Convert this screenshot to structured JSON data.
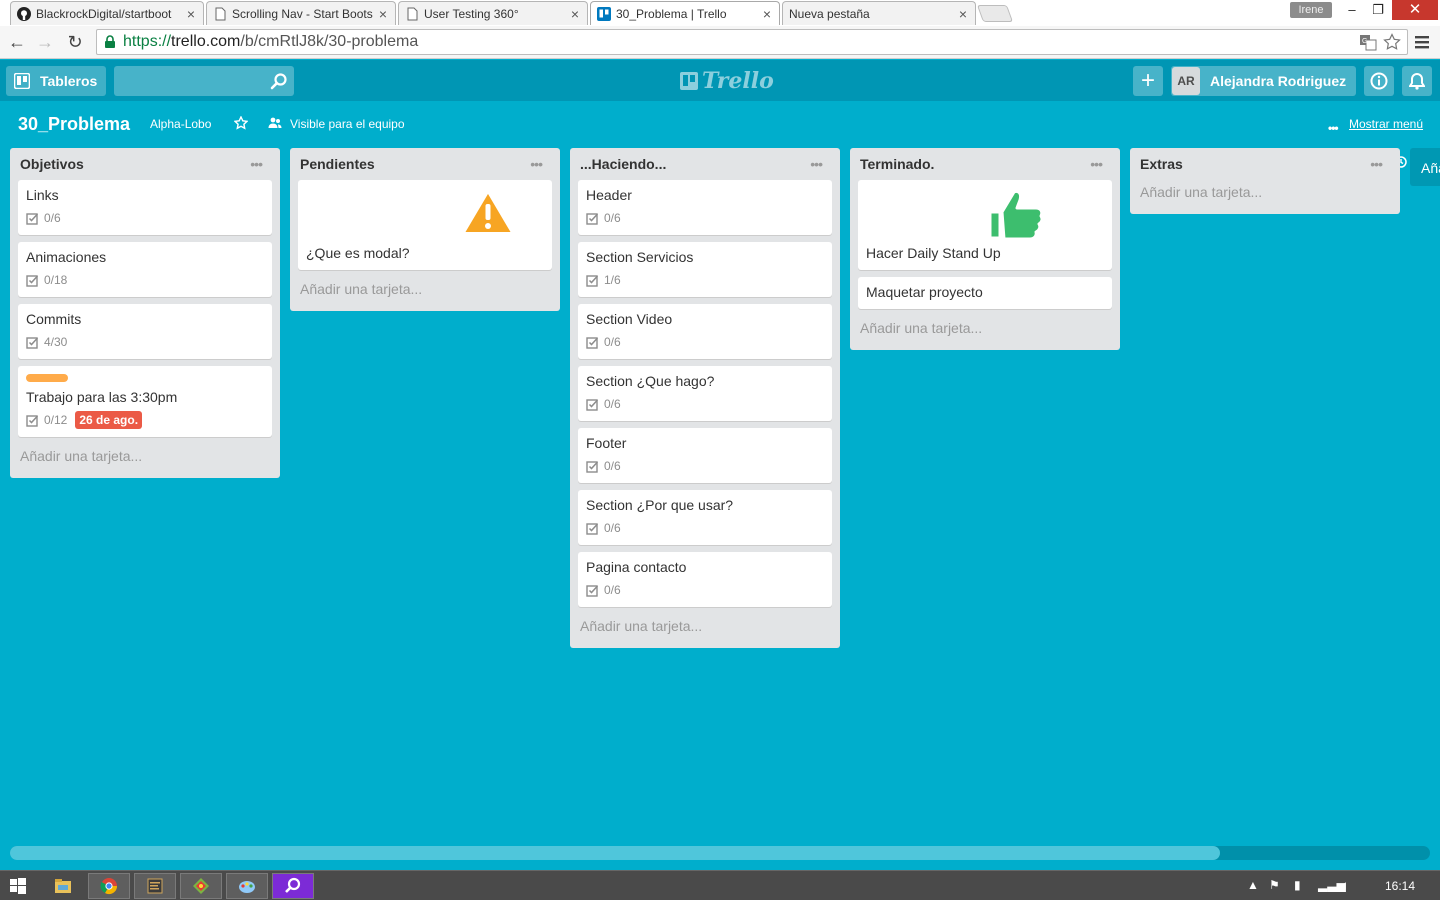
{
  "browser": {
    "tabs": [
      {
        "title": "BlackrockDigital/startboot",
        "icon": "github-icon",
        "active": false
      },
      {
        "title": "Scrolling Nav - Start Boots",
        "icon": "page-icon",
        "active": false
      },
      {
        "title": "User Testing 360°",
        "icon": "page-icon",
        "active": false
      },
      {
        "title": "30_Problema | Trello",
        "icon": "trello-icon",
        "active": true
      },
      {
        "title": "Nueva pestaña",
        "icon": "none",
        "active": false
      }
    ],
    "profile_name": "Irene",
    "url_scheme": "https://",
    "url_host": "trello.com",
    "url_path": "/b/cmRtlJ8k/30-problema"
  },
  "header": {
    "boards_label": "Tableros",
    "search_value": "",
    "logo_text": "Trello",
    "member_initials": "AR",
    "member_name": "Alejandra Rodriguez"
  },
  "board": {
    "title": "30_Problema",
    "team": "Alpha-Lobo",
    "visibility": "Visible para el equipo",
    "show_menu": "Mostrar menú",
    "add_card_label": "Añadir una tarjeta...",
    "partial_list_text": "Añadir una lista...",
    "lists": [
      {
        "title": "Objetivos",
        "cards": [
          {
            "title": "Links",
            "checklist": "0/6"
          },
          {
            "title": "Animaciones",
            "checklist": "0/18"
          },
          {
            "title": "Commits",
            "checklist": "4/30"
          },
          {
            "title": "Trabajo para las 3:30pm",
            "checklist": "0/12",
            "due": "26 de ago.",
            "label_color": "#FFAB4A"
          }
        ]
      },
      {
        "title": "Pendientes",
        "cards": [
          {
            "title": "¿Que es modal?",
            "cover": "warning-icon"
          }
        ]
      },
      {
        "title": "...Haciendo...",
        "cards": [
          {
            "title": "Header",
            "checklist": "0/6"
          },
          {
            "title": "Section Servicios",
            "checklist": "1/6"
          },
          {
            "title": "Section Video",
            "checklist": "0/6"
          },
          {
            "title": "Section ¿Que hago?",
            "checklist": "0/6"
          },
          {
            "title": "Footer",
            "checklist": "0/6"
          },
          {
            "title": "Section ¿Por que usar?",
            "checklist": "0/6"
          },
          {
            "title": "Pagina contacto",
            "checklist": "0/6"
          }
        ]
      },
      {
        "title": "Terminado.",
        "cards": [
          {
            "title": "Hacer Daily Stand Up",
            "cover": "thumbs-up-icon"
          },
          {
            "title": "Maquetar proyecto"
          }
        ]
      },
      {
        "title": "Extras",
        "cards": []
      }
    ]
  },
  "taskbar": {
    "clock": "16:14"
  },
  "colors": {
    "board_bg": "#00AECC",
    "header_bg": "#0096B4",
    "due_badge": "#EB5A46",
    "label_orange": "#FFAB4A"
  }
}
